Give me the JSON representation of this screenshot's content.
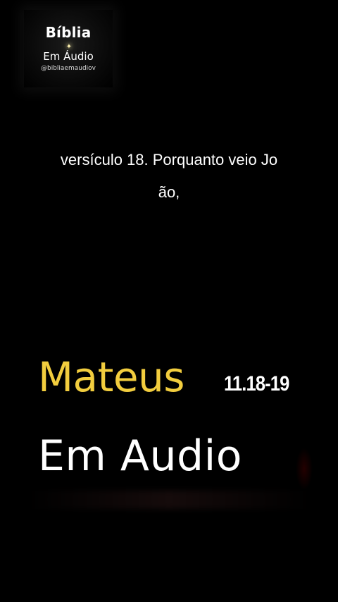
{
  "logo": {
    "title": "Bíblia",
    "subtitle": "Em Áudio",
    "handle": "@bibliaemaudiov"
  },
  "caption": {
    "line1": "versículo 18. Porquanto veio Jo",
    "line2": "ão,"
  },
  "headline": {
    "book": "Mateus",
    "reference": "11.18-19",
    "brand": "Em Audio"
  },
  "colors": {
    "background": "#000000",
    "accent_gold": "#f2cd3e",
    "text": "#ffffff"
  }
}
